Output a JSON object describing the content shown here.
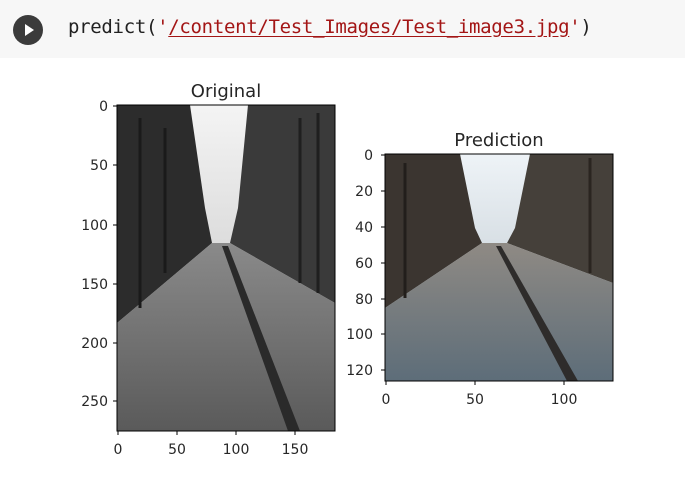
{
  "cell": {
    "code_fn": "predict(",
    "code_q1": "'",
    "code_path": "/content/Test_Images/Test_image3.jpg",
    "code_q2": "'",
    "code_close": ")"
  },
  "figures": {
    "original": {
      "title": "Original",
      "xticks": [
        "0",
        "50",
        "100",
        "150"
      ],
      "yticks": [
        "0",
        "50",
        "100",
        "150",
        "200",
        "250"
      ]
    },
    "prediction": {
      "title": "Prediction",
      "xticks": [
        "0",
        "50",
        "100"
      ],
      "yticks": [
        "0",
        "20",
        "40",
        "60",
        "80",
        "100",
        "120"
      ]
    }
  }
}
